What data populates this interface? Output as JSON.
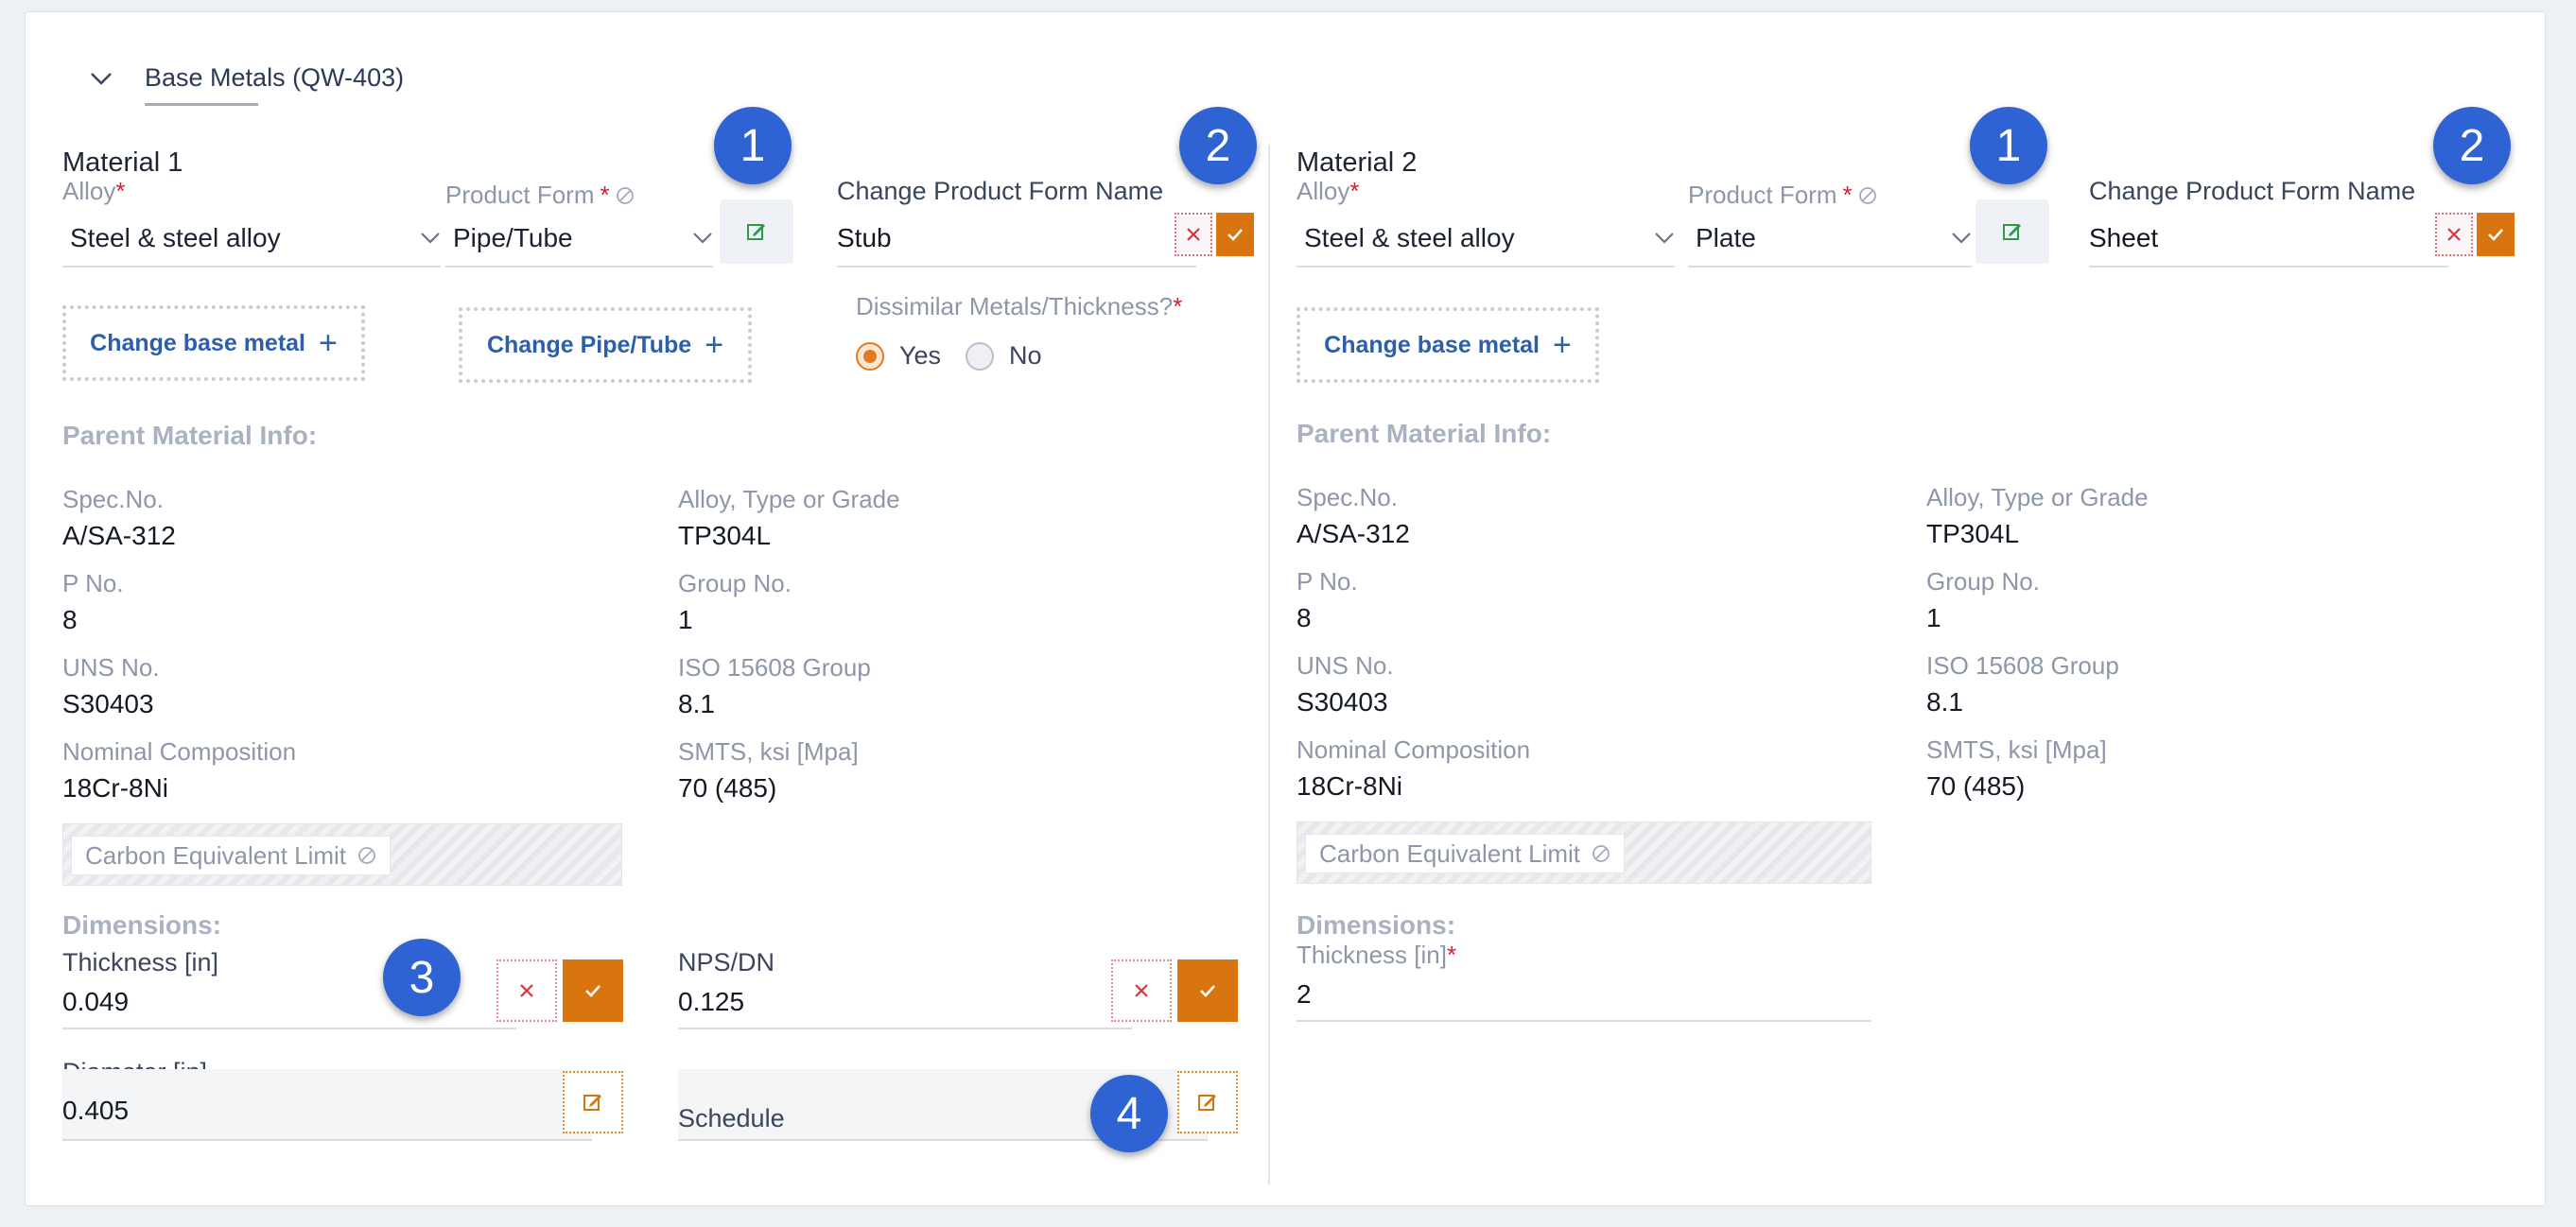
{
  "section": {
    "title": "Base Metals (QW-403)"
  },
  "material1": {
    "title": "Material 1",
    "alloy_label": "Alloy",
    "alloy_value": "Steel & steel alloy",
    "product_form_label": "Product Form",
    "product_form_value": "Pipe/Tube",
    "change_name_label": "Change Product Form Name",
    "change_name_value": "Stub",
    "change_base_metal": "Change base metal",
    "change_product": "Change Pipe/Tube",
    "dissimilar_label": "Dissimilar Metals/Thickness?",
    "radio_yes": "Yes",
    "radio_no": "No",
    "parent_info_title": "Parent Material Info:",
    "spec_label": "Spec.No.",
    "spec_value": "A/SA-312",
    "alloy_type_label": "Alloy, Type or Grade",
    "alloy_type_value": "TP304L",
    "pno_label": "P No.",
    "pno_value": "8",
    "group_label": "Group No.",
    "group_value": "1",
    "uns_label": "UNS No.",
    "uns_value": "S30403",
    "iso_label": "ISO 15608 Group",
    "iso_value": "8.1",
    "nominal_label": "Nominal Composition",
    "nominal_value": "18Cr-8Ni",
    "smts_label": "SMTS, ksi [Mpa]",
    "smts_value": "70 (485)",
    "cel_label": "Carbon Equivalent Limit",
    "dimensions_title": "Dimensions:",
    "thickness_label": "Thickness [in]",
    "thickness_value": "0.049",
    "nps_label": "NPS/DN",
    "nps_value": "0.125",
    "diameter_label": "Diameter [in]",
    "diameter_value": "0.405",
    "schedule_label": "Schedule"
  },
  "material2": {
    "title": "Material 2",
    "alloy_label": "Alloy",
    "alloy_value": "Steel & steel alloy",
    "product_form_label": "Product Form",
    "product_form_value": "Plate",
    "change_name_label": "Change Product Form Name",
    "change_name_value": "Sheet",
    "change_base_metal": "Change base metal",
    "parent_info_title": "Parent Material Info:",
    "spec_label": "Spec.No.",
    "spec_value": "A/SA-312",
    "alloy_type_label": "Alloy, Type or Grade",
    "alloy_type_value": "TP304L",
    "pno_label": "P No.",
    "pno_value": "8",
    "group_label": "Group No.",
    "group_value": "1",
    "uns_label": "UNS No.",
    "uns_value": "S30403",
    "iso_label": "ISO 15608 Group",
    "iso_value": "8.1",
    "nominal_label": "Nominal Composition",
    "nominal_value": "18Cr-8Ni",
    "smts_label": "SMTS, ksi [Mpa]",
    "smts_value": "70 (485)",
    "cel_label": "Carbon Equivalent Limit",
    "dimensions_title": "Dimensions:",
    "thickness_label": "Thickness [in]",
    "thickness_value": "2"
  },
  "badges": {
    "one": "1",
    "two": "2",
    "three": "3",
    "four": "4"
  },
  "icons": {
    "chevron": "chevron-down-icon",
    "edit": "edit-icon",
    "close": "close-icon",
    "check": "check-icon",
    "plus": "plus-icon",
    "disabled": "disabled-icon"
  },
  "colors": {
    "accent": "#d9750e",
    "badge": "#2f63d3",
    "link": "#2c5fa8",
    "required": "#d61f2c"
  }
}
